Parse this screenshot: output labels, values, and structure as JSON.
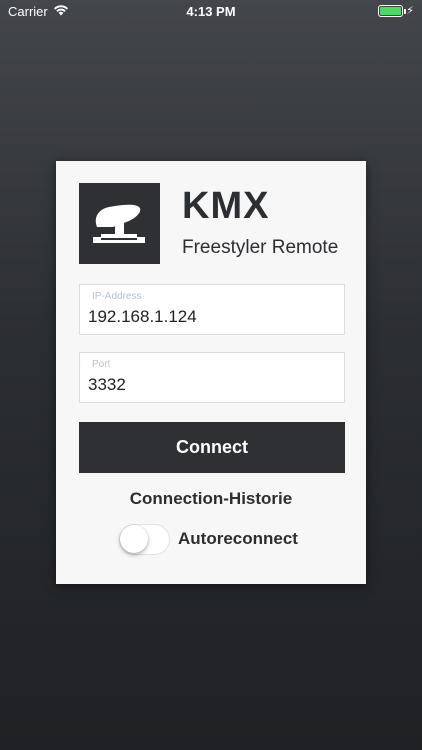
{
  "status_bar": {
    "carrier": "Carrier",
    "time": "4:13 PM",
    "battery_level": 1.0,
    "battery_color": "#4cd964"
  },
  "app": {
    "title": "KMX",
    "subtitle": "Freestyler Remote",
    "logo_icon": "moving-head-light-icon"
  },
  "form": {
    "ip": {
      "label": "IP-Address",
      "value": "192.168.1.124"
    },
    "port": {
      "label": "Port",
      "value": "3332"
    },
    "connect_label": "Connect",
    "history_label": "Connection-Historie",
    "autoreconnect": {
      "label": "Autoreconnect",
      "on": false
    }
  },
  "colors": {
    "dark": "#2e3034",
    "card": "#f7f7f7",
    "field_label": "#b8c2cc"
  }
}
